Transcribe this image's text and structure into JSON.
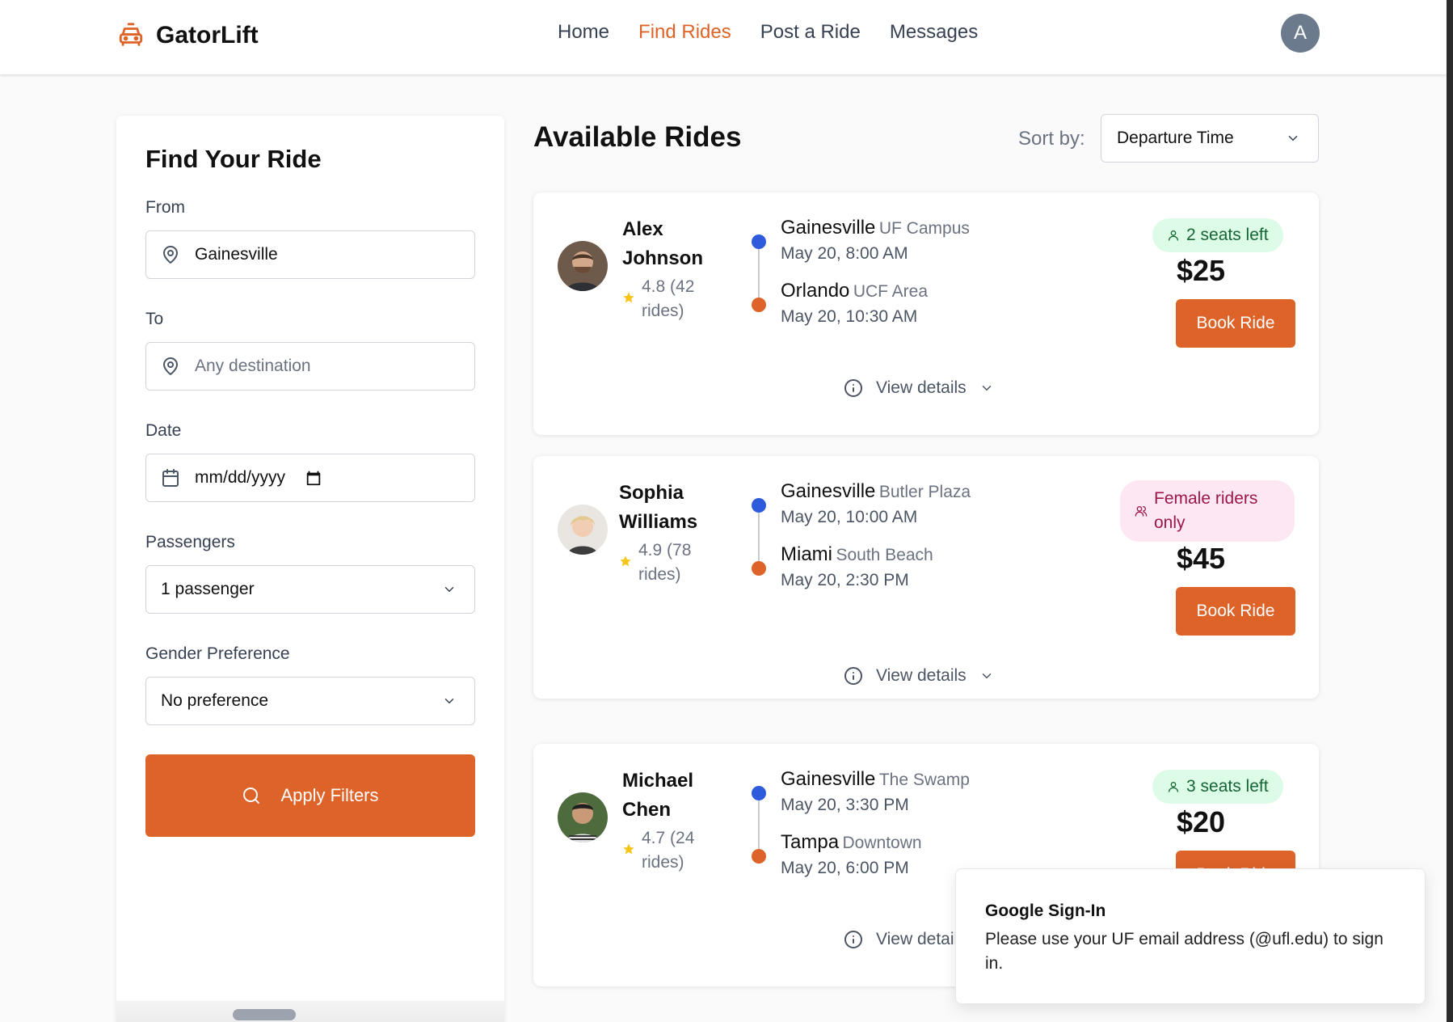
{
  "header": {
    "brand": "GatorLift",
    "nav": [
      "Home",
      "Find Rides",
      "Post a Ride",
      "Messages"
    ],
    "active_nav": "Find Rides",
    "avatar_initial": "A"
  },
  "filters": {
    "title": "Find Your Ride",
    "from_label": "From",
    "from_value": "Gainesville",
    "to_label": "To",
    "to_placeholder": "Any destination",
    "date_label": "Date",
    "date_placeholder": "mm/dd/yyyy",
    "passengers_label": "Passengers",
    "passengers_value": "1 passenger",
    "gender_label": "Gender Preference",
    "gender_value": "No preference",
    "apply_label": "Apply Filters"
  },
  "main": {
    "title": "Available Rides",
    "sort_label": "Sort by:",
    "sort_value": "Departure Time",
    "view_details": "View details",
    "book_label": "Book Ride"
  },
  "rides": [
    {
      "driver": "Alex Johnson",
      "rating": "4.8 (42 rides)",
      "from_city": "Gainesville",
      "from_area": "UF Campus",
      "depart": "May 20, 8:00 AM",
      "to_city": "Orlando",
      "to_area": "UCF Area",
      "arrive": "May 20, 10:30 AM",
      "badge": "2 seats left",
      "badge_type": "seats",
      "price": "$25"
    },
    {
      "driver": "Sophia Williams",
      "rating": "4.9 (78 rides)",
      "from_city": "Gainesville",
      "from_area": "Butler Plaza",
      "depart": "May 20, 10:00 AM",
      "to_city": "Miami",
      "to_area": "South Beach",
      "arrive": "May 20, 2:30 PM",
      "badge": "Female riders only",
      "badge_type": "female",
      "price": "$45"
    },
    {
      "driver": "Michael Chen",
      "rating": "4.7 (24 rides)",
      "from_city": "Gainesville",
      "from_area": "The Swamp",
      "depart": "May 20, 3:30 PM",
      "to_city": "Tampa",
      "to_area": "Downtown",
      "arrive": "May 20, 6:00 PM",
      "badge": "3 seats left",
      "badge_type": "seats",
      "price": "$20"
    }
  ],
  "toast": {
    "title": "Google Sign-In",
    "body": "Please use your UF email address (@ufl.edu) to sign in."
  },
  "colors": {
    "accent": "#dd6328",
    "route_start": "#2d5bdb",
    "seats_badge_bg": "#dcfce7",
    "female_badge_bg": "#fce7f3"
  }
}
